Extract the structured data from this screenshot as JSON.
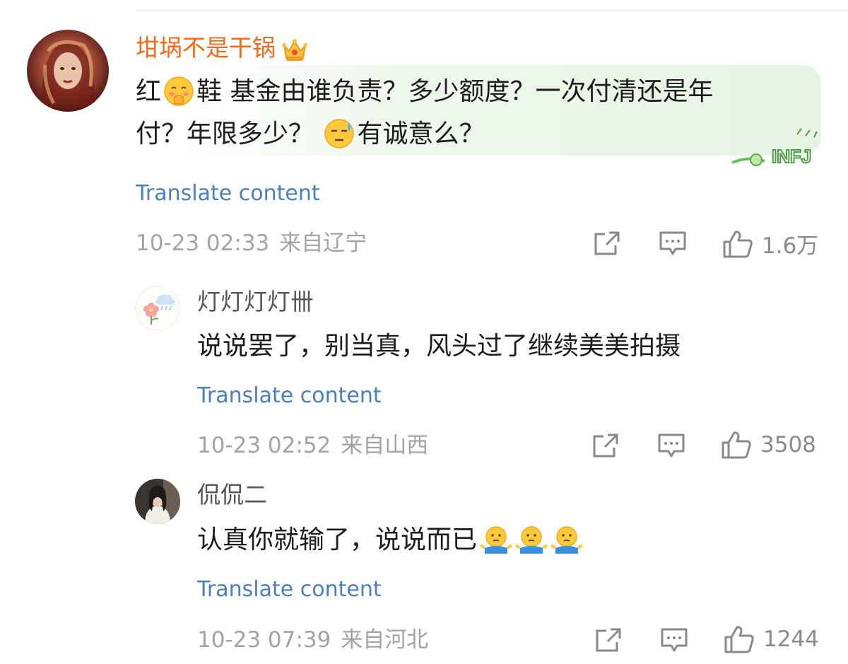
{
  "comments": [
    {
      "username": "坩埚不是干锅",
      "avatar_icon": "portrait-avatar",
      "badge_icon": "crown-icon",
      "text": {
        "part1": "红",
        "emoji1": "shy-face-emoji",
        "part2": "鞋 基金由谁负责？多少额度？一次付清还是年",
        "line2a": "付？年限多少？",
        "emoji2": "sweat-face-emoji",
        "line2b": "有诚意么？"
      },
      "bubble_badge": "INFJ",
      "translate_label": "Translate content",
      "timestamp": "10-23 02:33",
      "location": "来自辽宁",
      "likes": "1.6万"
    },
    {
      "username": "灯灯灯灯卌",
      "avatar_icon": "flower-cloud-avatar",
      "text": "说说罢了，别当真，风头过了继续美美拍摄",
      "translate_label": "Translate content",
      "timestamp": "10-23 02:52",
      "location": "来自山西",
      "likes": "3508"
    },
    {
      "username": "侃侃二",
      "avatar_icon": "photo-avatar",
      "text": "认真你就输了，说说而已",
      "emojis": [
        "shrug-emoji",
        "shrug-emoji",
        "shrug-emoji"
      ],
      "translate_label": "Translate content",
      "timestamp": "10-23 07:39",
      "location": "来自河北",
      "likes": "1244"
    }
  ],
  "colors": {
    "username_main": "#f26a18",
    "username_reply": "#555555",
    "translate": "#4a7fb8",
    "meta": "#a3a3a3",
    "icon": "#8a8a8a"
  }
}
